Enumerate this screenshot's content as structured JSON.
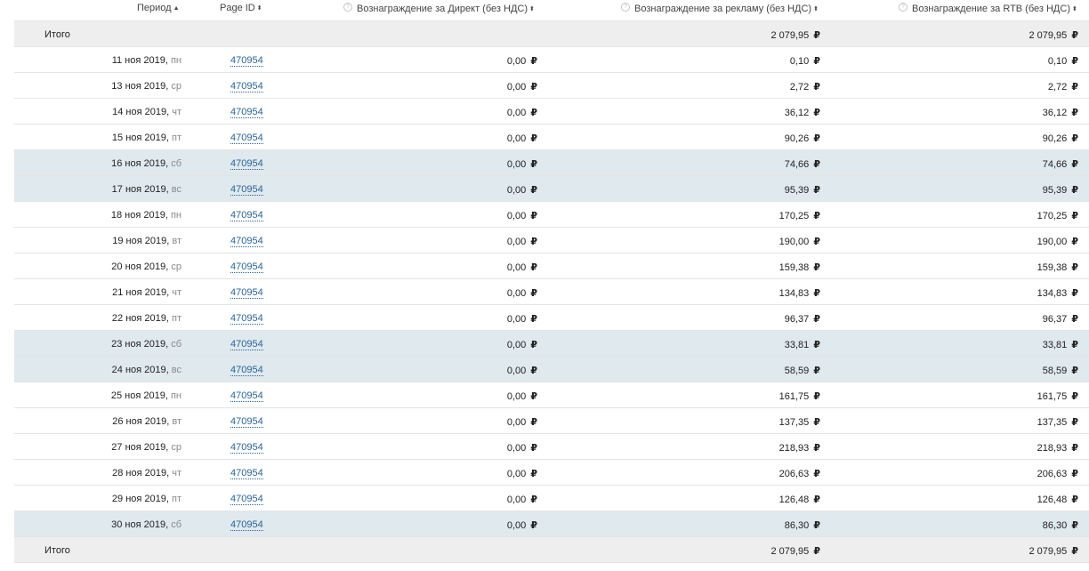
{
  "header": {
    "period": "Период",
    "page_id": "Page ID",
    "direct": "Вознаграждение за Директ (без НДС)",
    "ads": "Вознаграждение за рекламу (без НДС)",
    "rtb": "Вознаграждение за RTB (без НДС)"
  },
  "currency": "₽",
  "totals": {
    "label": "Итого",
    "ads": "2 079,95",
    "rtb": "2 079,95"
  },
  "rows": [
    {
      "date": "11 ноя 2019",
      "weekday": "пн",
      "page_id": "470954",
      "direct": "0,00",
      "ads": "0,10",
      "rtb": "0,10",
      "weekend": false
    },
    {
      "date": "13 ноя 2019",
      "weekday": "ср",
      "page_id": "470954",
      "direct": "0,00",
      "ads": "2,72",
      "rtb": "2,72",
      "weekend": false
    },
    {
      "date": "14 ноя 2019",
      "weekday": "чт",
      "page_id": "470954",
      "direct": "0,00",
      "ads": "36,12",
      "rtb": "36,12",
      "weekend": false
    },
    {
      "date": "15 ноя 2019",
      "weekday": "пт",
      "page_id": "470954",
      "direct": "0,00",
      "ads": "90,26",
      "rtb": "90,26",
      "weekend": false
    },
    {
      "date": "16 ноя 2019",
      "weekday": "сб",
      "page_id": "470954",
      "direct": "0,00",
      "ads": "74,66",
      "rtb": "74,66",
      "weekend": true
    },
    {
      "date": "17 ноя 2019",
      "weekday": "вс",
      "page_id": "470954",
      "direct": "0,00",
      "ads": "95,39",
      "rtb": "95,39",
      "weekend": true
    },
    {
      "date": "18 ноя 2019",
      "weekday": "пн",
      "page_id": "470954",
      "direct": "0,00",
      "ads": "170,25",
      "rtb": "170,25",
      "weekend": false
    },
    {
      "date": "19 ноя 2019",
      "weekday": "вт",
      "page_id": "470954",
      "direct": "0,00",
      "ads": "190,00",
      "rtb": "190,00",
      "weekend": false
    },
    {
      "date": "20 ноя 2019",
      "weekday": "ср",
      "page_id": "470954",
      "direct": "0,00",
      "ads": "159,38",
      "rtb": "159,38",
      "weekend": false
    },
    {
      "date": "21 ноя 2019",
      "weekday": "чт",
      "page_id": "470954",
      "direct": "0,00",
      "ads": "134,83",
      "rtb": "134,83",
      "weekend": false
    },
    {
      "date": "22 ноя 2019",
      "weekday": "пт",
      "page_id": "470954",
      "direct": "0,00",
      "ads": "96,37",
      "rtb": "96,37",
      "weekend": false
    },
    {
      "date": "23 ноя 2019",
      "weekday": "сб",
      "page_id": "470954",
      "direct": "0,00",
      "ads": "33,81",
      "rtb": "33,81",
      "weekend": true
    },
    {
      "date": "24 ноя 2019",
      "weekday": "вс",
      "page_id": "470954",
      "direct": "0,00",
      "ads": "58,59",
      "rtb": "58,59",
      "weekend": true
    },
    {
      "date": "25 ноя 2019",
      "weekday": "пн",
      "page_id": "470954",
      "direct": "0,00",
      "ads": "161,75",
      "rtb": "161,75",
      "weekend": false
    },
    {
      "date": "26 ноя 2019",
      "weekday": "вт",
      "page_id": "470954",
      "direct": "0,00",
      "ads": "137,35",
      "rtb": "137,35",
      "weekend": false
    },
    {
      "date": "27 ноя 2019",
      "weekday": "ср",
      "page_id": "470954",
      "direct": "0,00",
      "ads": "218,93",
      "rtb": "218,93",
      "weekend": false
    },
    {
      "date": "28 ноя 2019",
      "weekday": "чт",
      "page_id": "470954",
      "direct": "0,00",
      "ads": "206,63",
      "rtb": "206,63",
      "weekend": false
    },
    {
      "date": "29 ноя 2019",
      "weekday": "пт",
      "page_id": "470954",
      "direct": "0,00",
      "ads": "126,48",
      "rtb": "126,48",
      "weekend": false
    },
    {
      "date": "30 ноя 2019",
      "weekday": "сб",
      "page_id": "470954",
      "direct": "0,00",
      "ads": "86,30",
      "rtb": "86,30",
      "weekend": true
    }
  ]
}
